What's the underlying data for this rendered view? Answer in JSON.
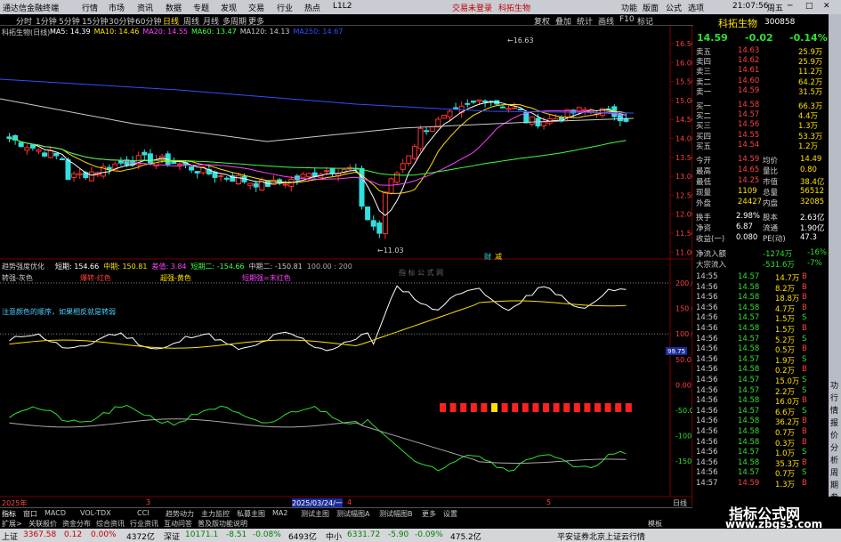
{
  "app": {
    "title": "通达信金融终端",
    "menu": [
      "行情",
      "市场",
      "资讯",
      "数据",
      "专题",
      "发现",
      "交易",
      "行业",
      "热点",
      "L1L2"
    ],
    "trade_login": "交易未登录",
    "stock_tab": "科拓生物",
    "right_menu": [
      "功能",
      "版面",
      "公式",
      "选项"
    ],
    "time": "21:07:56",
    "weekday": "周五"
  },
  "toolbar": {
    "periods": [
      "分时",
      "1分钟",
      "5分钟",
      "15分钟",
      "30分钟",
      "60分钟",
      "日线",
      "周线",
      "月线",
      "多周期",
      "更多"
    ],
    "right": [
      "复权",
      "叠加",
      "统计",
      "画线",
      "F10",
      "标记"
    ]
  },
  "kline": {
    "title": "科拓生物(日线)",
    "ma": [
      {
        "label": "MA5: 14.39",
        "color": "#ffffff"
      },
      {
        "label": "MA10: 14.46",
        "color": "#ffe000"
      },
      {
        "label": "MA20: 14.55",
        "color": "#ff40ff"
      },
      {
        "label": "MA60: 13.47",
        "color": "#40ff40"
      },
      {
        "label": "MA120: 14.13",
        "color": "#cccccc"
      },
      {
        "label": "MA250: 14.67",
        "color": "#3050ff"
      }
    ],
    "high_label": "16.63",
    "low_label": "11.03",
    "price_ticks": [
      "16.50",
      "16.00",
      "15.50",
      "15.00",
      "14.50",
      "14.00",
      "13.50",
      "13.00",
      "12.50",
      "12.00",
      "11.50",
      "11.00"
    ],
    "badges": [
      "财",
      "减"
    ]
  },
  "indicator": {
    "name": "趋势强度优化",
    "values": [
      {
        "label": "短期: 154.66",
        "color": "#ffffff"
      },
      {
        "label": "中期: 150.81",
        "color": "#ffe000"
      },
      {
        "label": "差值: 3.84",
        "color": "#ff40ff"
      },
      {
        "label": "短期二: -154.66",
        "color": "#40ff40"
      },
      {
        "label": "中期二: -150.81",
        "color": "#cccccc"
      },
      {
        "label": "100.00 : 200",
        "color": "#aaaaaa"
      }
    ],
    "watermark": "指 标 公 式 网",
    "legend": [
      {
        "label": "转强-灰色",
        "color": "#cccccc"
      },
      {
        "label": "爆转-红色",
        "color": "#ff4040"
      },
      {
        "label": "超强-黄色",
        "color": "#ffe000"
      },
      {
        "label": "短期强=末红色",
        "color": "#ff40ff"
      }
    ],
    "note": "注意颜色的顺序，如果相反就是转弱",
    "ticks": [
      "200.0",
      "150.0",
      "100.0",
      "50.0",
      "0.00",
      "-50.0",
      "-100.0",
      "-150.0"
    ],
    "current_tag": "99.75"
  },
  "xaxis": {
    "labels": [
      "2025年",
      "3",
      "2025/03/24/一",
      "4",
      "5"
    ],
    "day_label": "日线"
  },
  "tabs": [
    "指标",
    "窗口",
    "MACD",
    "VOL-TDX",
    "CCI",
    "趋势动力",
    "主力监控",
    "私募主图",
    "MA2",
    "测试主图",
    "测试幅图A",
    "测试幅图B",
    "更多",
    "设置"
  ],
  "tabs2": [
    "扩展>",
    "关联报价",
    "资金分布",
    "综合资讯",
    "行业资讯",
    "互动问答",
    "普及版功能说明"
  ],
  "tabs2_right": [
    "模板",
    "图文F10"
  ],
  "quote": {
    "name": "科拓生物",
    "code": "300858",
    "price": "14.59",
    "change": "-0.02",
    "pct": "-0.14%",
    "asks": [
      [
        "卖五",
        "14.63",
        "25.9万"
      ],
      [
        "卖四",
        "14.62",
        "25.9万"
      ],
      [
        "卖三",
        "14.61",
        "11.2万"
      ],
      [
        "卖二",
        "14.60",
        "64.2万"
      ],
      [
        "卖一",
        "14.59",
        "31.5万"
      ]
    ],
    "bids": [
      [
        "买一",
        "14.58",
        "66.3万"
      ],
      [
        "买二",
        "14.57",
        "4.4万"
      ],
      [
        "买三",
        "14.56",
        "1.3万"
      ],
      [
        "买四",
        "14.55",
        "53.3万"
      ],
      [
        "买五",
        "14.54",
        "1.2万"
      ]
    ],
    "stats": [
      [
        "今开",
        "14.59",
        "均价",
        "14.49"
      ],
      [
        "最高",
        "14.65",
        "量比",
        "0.80"
      ],
      [
        "最低",
        "14.25",
        "市值",
        "38.4亿"
      ],
      [
        "现量",
        "1109",
        "总量",
        "56512"
      ],
      [
        "外盘",
        "24427",
        "内盘",
        "32085"
      ]
    ],
    "stats2": [
      [
        "换手",
        "2.98%",
        "股本",
        "2.63亿"
      ],
      [
        "净资",
        "6.87",
        "流通",
        "1.90亿"
      ],
      [
        "收益(一)",
        "0.080",
        "PE(动)",
        "47.3"
      ]
    ],
    "flow": [
      [
        "净流入额",
        "-1274万",
        "-16%"
      ],
      [
        "大宗流入",
        "-531.6万",
        "-7%"
      ]
    ],
    "ticks": [
      [
        "14:55",
        "14.57",
        "14.7万",
        "B"
      ],
      [
        "14:56",
        "14.58",
        "8.2万",
        "B"
      ],
      [
        "14:56",
        "14.58",
        "18.8万",
        "B"
      ],
      [
        "14:56",
        "14.58",
        "4.7万",
        "B"
      ],
      [
        "14:56",
        "14.57",
        "1.5万",
        "S"
      ],
      [
        "14:56",
        "14.58",
        "1.5万",
        "B"
      ],
      [
        "14:56",
        "14.57",
        "5.2万",
        "S"
      ],
      [
        "14:56",
        "14.58",
        "0.5万",
        "B"
      ],
      [
        "14:56",
        "14.57",
        "1.9万",
        "S"
      ],
      [
        "14:56",
        "14.58",
        "0.2万",
        "B"
      ],
      [
        "14:56",
        "14.57",
        "15.0万",
        "S"
      ],
      [
        "14:56",
        "14.57",
        "2.2万",
        "S"
      ],
      [
        "14:56",
        "14.58",
        "16.0万",
        "B"
      ],
      [
        "14:56",
        "14.57",
        "6.6万",
        "S"
      ],
      [
        "14:56",
        "14.58",
        "36.2万",
        "B"
      ],
      [
        "14:56",
        "14.58",
        "0.7万",
        "B"
      ],
      [
        "14:56",
        "14.58",
        "0.3万",
        "B"
      ],
      [
        "14:56",
        "14.57",
        "1.0万",
        "S"
      ],
      [
        "14:56",
        "14.58",
        "35.3万",
        "B"
      ],
      [
        "14:56",
        "14.57",
        "0.7万",
        "S"
      ],
      [
        "14:57",
        "14.59",
        "1.3万",
        "B"
      ]
    ]
  },
  "status": {
    "items": [
      {
        "label": "上证",
        "val": "3367.58",
        "chg": "0.12",
        "pct": "0.00%",
        "amt": "4372亿",
        "c": "#c00000"
      },
      {
        "label": "深证",
        "val": "10171.1",
        "chg": "-8.51",
        "pct": "-0.08%",
        "amt": "6493亿",
        "c": "#008000"
      },
      {
        "label": "中小",
        "val": "6331.72",
        "chg": "-5.90",
        "pct": "-0.09%",
        "amt": "475.2亿",
        "c": "#008000"
      }
    ],
    "broker": "平安证券北京上证云行情"
  },
  "watermark": {
    "line1": "指标公式网",
    "line2": "www.zbgs3.com"
  },
  "colors": {
    "up": "#ff3030",
    "down": "#30e0e0",
    "bg": "#000000"
  }
}
